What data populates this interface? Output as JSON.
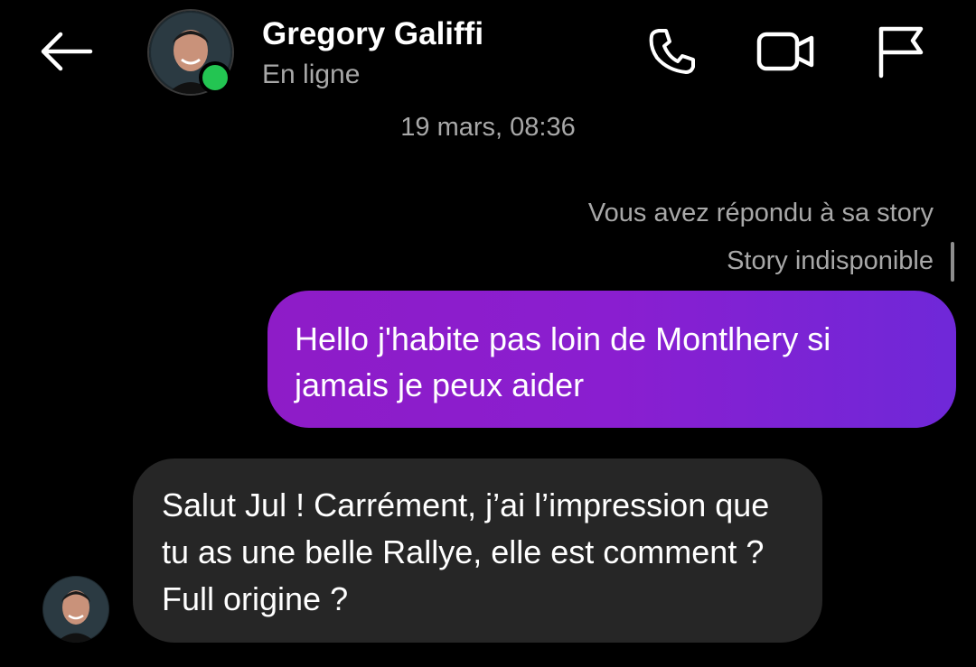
{
  "header": {
    "contact_name": "Gregory Galiffi",
    "status": "En ligne",
    "icons": {
      "back": "back-arrow-icon",
      "call": "phone-icon",
      "video": "video-camera-icon",
      "report": "flag-icon"
    },
    "online_color": "#23c552"
  },
  "conversation": {
    "timestamp": "19 mars, 08:36",
    "reply_note": "Vous avez répondu à sa story",
    "story_unavailable": "Story indisponible",
    "messages": [
      {
        "sender": "me",
        "text": "Hello j'habite pas loin de Montlhery si jamais je peux aider"
      },
      {
        "sender": "contact",
        "text": "Salut Jul ! Carrément, j’ai l’impression que tu as une belle Rallye, elle est comment ? Full origine ?"
      }
    ]
  },
  "colors": {
    "background": "#000000",
    "sent_bubble": "#8a1ed0",
    "received_bubble": "#262626",
    "secondary_text": "#a8a8a8"
  }
}
